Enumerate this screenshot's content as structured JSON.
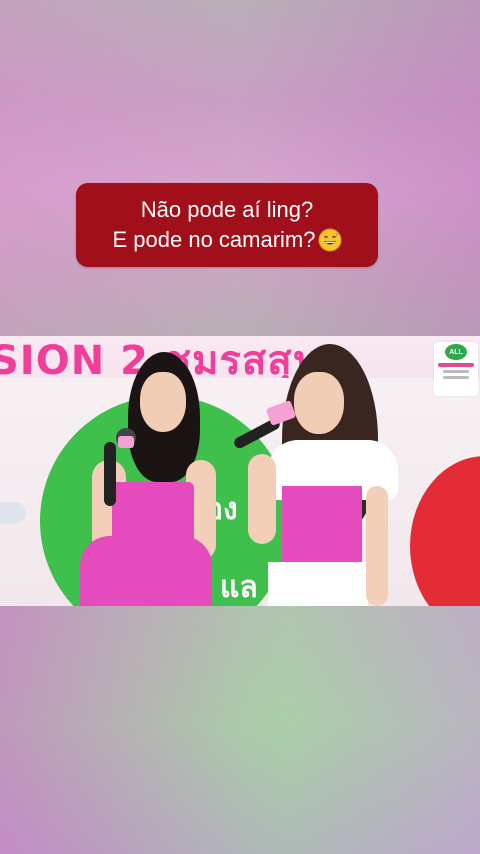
{
  "caption": {
    "line1": "Não pode aí ling?",
    "line2": "E pode no camarim?",
    "emoji": "grinning-sweat-emoji",
    "background": "#a10f1a",
    "text_color": "#ffffff"
  },
  "video": {
    "banner_text": "SION 2 ชมรสสุน",
    "stage_text_1": "อง",
    "stage_text_2": "แล",
    "logo": {
      "badge": "ALL",
      "accent": "#2ea64a"
    },
    "colors": {
      "pink_outfit": "#e54bbd",
      "green_circle": "#3fbf4c",
      "red_circle": "#e32c36",
      "banner_pink": "#f03f9a"
    }
  }
}
